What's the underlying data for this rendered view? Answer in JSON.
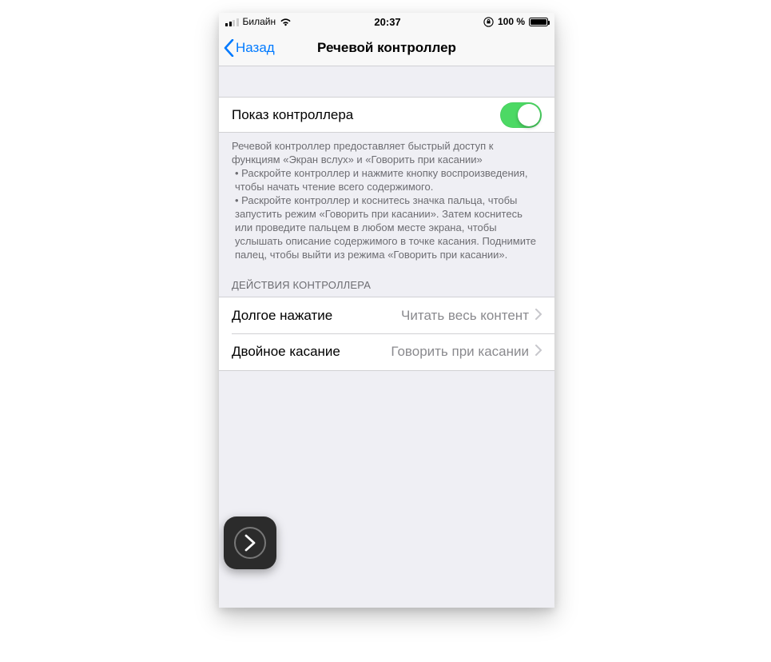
{
  "status": {
    "carrier": "Билайн",
    "time": "20:37",
    "battery_text": "100 %",
    "signal_bars_active": 2,
    "signal_bars_total": 4
  },
  "nav": {
    "back_label": "Назад",
    "title": "Речевой контроллер"
  },
  "toggle_row": {
    "label": "Показ контроллера",
    "on": true
  },
  "description": {
    "intro": "Речевой контроллер предоставляет быстрый доступ к функциям «Экран вслух» и «Говорить при касании»",
    "bullet1": " • Раскройте контроллер и нажмите кнопку воспроизведения, чтобы начать чтение всего содержимого.",
    "bullet2": " • Раскройте контроллер и коснитесь значка пальца, чтобы запустить режим «Говорить при касании». Затем коснитесь или проведите пальцем в любом месте экрана, чтобы услышать описание содержимого в точке касания. Поднимите палец, чтобы выйти из режима «Говорить при касании»."
  },
  "actions_header": "ДЕЙСТВИЯ КОНТРОЛЛЕРА",
  "actions": [
    {
      "label": "Долгое нажатие",
      "value": "Читать весь контент"
    },
    {
      "label": "Двойное касание",
      "value": "Говорить при касании"
    }
  ]
}
